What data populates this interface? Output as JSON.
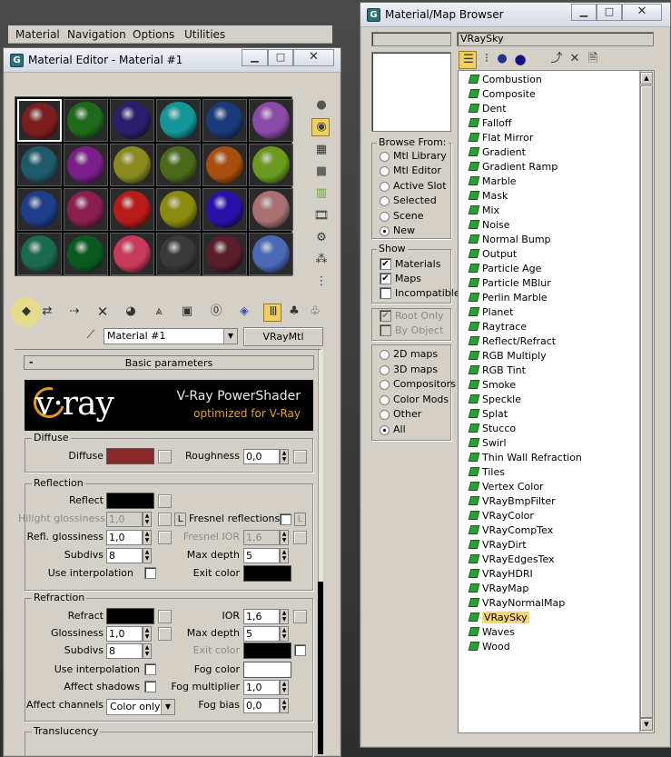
{
  "material_editor": {
    "title": "Material Editor - Material #1",
    "menu": [
      "Material",
      "Navigation",
      "Options",
      "Utilities"
    ],
    "slot_colors": [
      "#7a1e1e",
      "#1d6a1a",
      "#2c1e6e",
      "#149696",
      "#1a3a7a",
      "#8a4aa8",
      "#1e5a6a",
      "#7a1e8a",
      "#8a8a1e",
      "#4a6a1a",
      "#a84e10",
      "#6a9a20",
      "#1e3e8a",
      "#8a1e4e",
      "#b81a1a",
      "#8a8a10",
      "#2a10a8",
      "#a87070",
      "#1a6a4e",
      "#0a5a20",
      "#c83a5a",
      "#3a3a3a",
      "#5a1e2a",
      "#4a6ab8"
    ],
    "material_name": "Material #1",
    "material_type": "VRayMtl",
    "rollout_title": "Basic parameters",
    "banner": {
      "logo": "v·ray",
      "line1": "V-Ray PowerShader",
      "line2": "optimized for V-Ray"
    },
    "diffuse": {
      "group": "Diffuse",
      "label": "Diffuse",
      "color": "#8a2a2a",
      "roughness_label": "Roughness",
      "roughness": "0,0"
    },
    "reflection": {
      "group": "Reflection",
      "reflect_label": "Reflect",
      "reflect_color": "#000000",
      "hilight_label": "Hilight glossiness",
      "hilight": "1,0",
      "fresnel_label": "Fresnel reflections",
      "l_label": "L",
      "refl_gloss_label": "Refl. glossiness",
      "refl_gloss": "1,0",
      "fresnel_ior_label": "Fresnel IOR",
      "fresnel_ior": "1,6",
      "subdivs_label": "Subdivs",
      "subdivs": "8",
      "max_depth_label": "Max depth",
      "max_depth": "5",
      "use_interp_label": "Use interpolation",
      "exit_color_label": "Exit color",
      "exit_color": "#000000"
    },
    "refraction": {
      "group": "Refraction",
      "refract_label": "Refract",
      "refract_color": "#000000",
      "ior_label": "IOR",
      "ior": "1,6",
      "gloss_label": "Glossiness",
      "gloss": "1,0",
      "max_depth_label": "Max depth",
      "max_depth": "5",
      "subdivs_label": "Subdivs",
      "subdivs": "8",
      "exit_color_label": "Exit color",
      "exit_color": "#000000",
      "use_interp_label": "Use interpolation",
      "fog_color_label": "Fog color",
      "fog_color": "#ffffff",
      "affect_shadows_label": "Affect shadows",
      "fog_mult_label": "Fog multiplier",
      "fog_mult": "1,0",
      "affect_channels_label": "Affect channels",
      "affect_channels": "Color only",
      "fog_bias_label": "Fog bias",
      "fog_bias": "0,0"
    },
    "translucency": {
      "group": "Translucency"
    }
  },
  "browser": {
    "title": "Material/Map Browser",
    "name_field": "VRaySky",
    "browse_from_title": "Browse From:",
    "browse_from": [
      {
        "label": "Mtl Library",
        "on": false
      },
      {
        "label": "Mtl Editor",
        "on": false
      },
      {
        "label": "Active Slot",
        "on": false
      },
      {
        "label": "Selected",
        "on": false
      },
      {
        "label": "Scene",
        "on": false
      },
      {
        "label": "New",
        "on": true
      }
    ],
    "show_title": "Show",
    "show": [
      {
        "label": "Materials",
        "checked": true
      },
      {
        "label": "Maps",
        "checked": true
      },
      {
        "label": "Incompatible",
        "checked": false
      }
    ],
    "root_only": "Root Only",
    "by_object": "By Object",
    "map_filters": [
      {
        "label": "2D maps",
        "on": false
      },
      {
        "label": "3D maps",
        "on": false
      },
      {
        "label": "Compositors",
        "on": false
      },
      {
        "label": "Color Mods",
        "on": false
      },
      {
        "label": "Other",
        "on": false
      },
      {
        "label": "All",
        "on": true
      }
    ],
    "items": [
      "Combustion",
      "Composite",
      "Dent",
      "Falloff",
      "Flat Mirror",
      "Gradient",
      "Gradient Ramp",
      "Marble",
      "Mask",
      "Mix",
      "Noise",
      "Normal Bump",
      "Output",
      "Particle Age",
      "Particle MBlur",
      "Perlin Marble",
      "Planet",
      "Raytrace",
      "Reflect/Refract",
      "RGB Multiply",
      "RGB Tint",
      "Smoke",
      "Speckle",
      "Splat",
      "Stucco",
      "Swirl",
      "Thin Wall Refraction",
      "Tiles",
      "Vertex Color",
      "VRayBmpFilter",
      "VRayColor",
      "VRayCompTex",
      "VRayDirt",
      "VRayEdgesTex",
      "VRayHDRI",
      "VRayMap",
      "VRayNormalMap",
      "VRaySky",
      "Waves",
      "Wood"
    ],
    "selected_item": "VRaySky"
  }
}
